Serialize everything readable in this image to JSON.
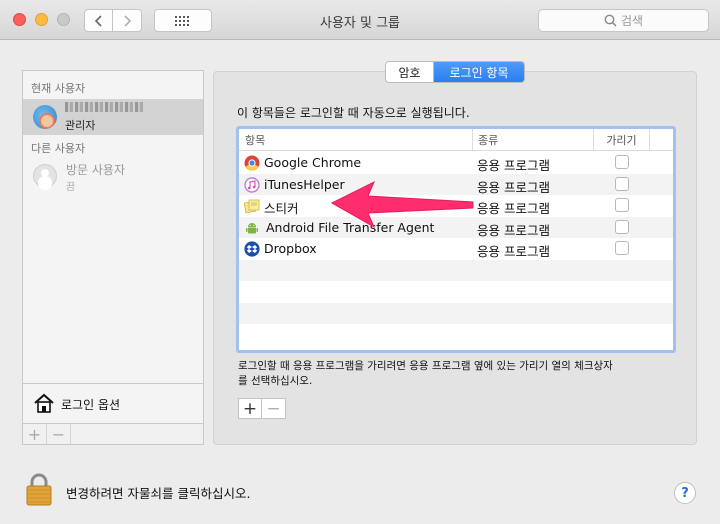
{
  "window": {
    "title": "사용자 및 그룹"
  },
  "search": {
    "placeholder": "검색"
  },
  "sidebar": {
    "current_user_header": "현재 사용자",
    "current_user": {
      "role": "관리자"
    },
    "other_users_header": "다른 사용자",
    "guest": {
      "name": "방문 사용자",
      "status": "끔"
    },
    "login_options_label": "로그인 옵션"
  },
  "tabs": {
    "password": "암호",
    "login_items": "로그인 항목"
  },
  "main": {
    "description": "이 항목들은 로그인할 때 자동으로 실행됩니다.",
    "columns": {
      "name": "항목",
      "kind": "종류",
      "hide": "가리기"
    },
    "rows": [
      {
        "name": "Google Chrome",
        "kind": "응용 프로그램",
        "icon": "chrome-icon",
        "hidden": false
      },
      {
        "name": "iTunesHelper",
        "kind": "응용 프로그램",
        "icon": "itunes-icon",
        "hidden": false
      },
      {
        "name": "스티커",
        "kind": "응용 프로그램",
        "icon": "stickies-icon",
        "hidden": false
      },
      {
        "name": "Android File Transfer Agent",
        "kind": "응용 프로그램",
        "icon": "android-icon",
        "hidden": false
      },
      {
        "name": "Dropbox",
        "kind": "응용 프로그램",
        "icon": "dropbox-icon",
        "hidden": false
      }
    ],
    "hint_line1": "로그인할 때 응용 프로그램을 가리려면 응용 프로그램 옆에 있는 가리기 열의 체크상자",
    "hint_line2": "를 선택하십시오.",
    "plus": "+",
    "minus": "−"
  },
  "footer": {
    "lock_text": "변경하려면 자물쇠를 클릭하십시오.",
    "help": "?"
  },
  "colors": {
    "accent": "#2a7ef0",
    "annotation_arrow": "#ff2d6e"
  }
}
